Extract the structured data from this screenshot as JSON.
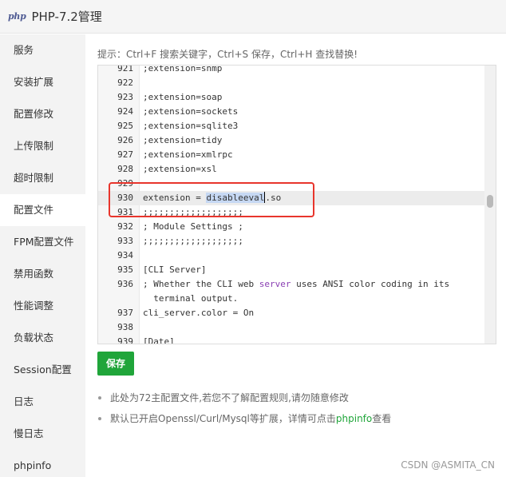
{
  "window": {
    "logo_text": "php",
    "title": "PHP-7.2管理"
  },
  "sidebar": {
    "items": [
      {
        "label": "服务"
      },
      {
        "label": "安装扩展"
      },
      {
        "label": "配置修改"
      },
      {
        "label": "上传限制"
      },
      {
        "label": "超时限制"
      },
      {
        "label": "配置文件",
        "active": true
      },
      {
        "label": "FPM配置文件"
      },
      {
        "label": "禁用函数"
      },
      {
        "label": "性能调整"
      },
      {
        "label": "负载状态"
      },
      {
        "label": "Session配置"
      },
      {
        "label": "日志"
      },
      {
        "label": "慢日志"
      },
      {
        "label": "phpinfo"
      }
    ]
  },
  "main": {
    "hint": "提示：Ctrl+F 搜索关键字，Ctrl+S 保存，Ctrl+H 查找替换!",
    "save_label": "保存",
    "notes": [
      {
        "text": "此处为72主配置文件,若您不了解配置规则,请勿随意修改"
      },
      {
        "text_before": "默认已开启Openssl/Curl/Mysql等扩展，详情可点击",
        "link": "phpinfo",
        "text_after": "查看"
      }
    ]
  },
  "editor": {
    "lines": [
      {
        "num": "921",
        "text": ";extension=snmp"
      },
      {
        "num": "922",
        "text": ""
      },
      {
        "num": "923",
        "text": ";extension=soap"
      },
      {
        "num": "924",
        "text": ";extension=sockets"
      },
      {
        "num": "925",
        "text": ";extension=sqlite3"
      },
      {
        "num": "926",
        "text": ";extension=tidy"
      },
      {
        "num": "927",
        "text": ";extension=xmlrpc"
      },
      {
        "num": "928",
        "text": ";extension=xsl"
      },
      {
        "num": "929",
        "text": ""
      },
      {
        "num": "930",
        "text_before": "extension = ",
        "selected": "disableeval",
        "text_after": ".so",
        "current": true
      },
      {
        "num": "931",
        "text": ";;;;;;;;;;;;;;;;;;;"
      },
      {
        "num": "932",
        "text": "; Module Settings ;"
      },
      {
        "num": "933",
        "text": ";;;;;;;;;;;;;;;;;;;"
      },
      {
        "num": "934",
        "text": ""
      },
      {
        "num": "935",
        "text": "[CLI Server]"
      },
      {
        "num": "936",
        "text_before": "; Whether the CLI web ",
        "keyword": "server",
        "text_after": " uses ANSI color coding in its"
      },
      {
        "num": "",
        "text": "  terminal output."
      },
      {
        "num": "937",
        "text": "cli_server.color = On"
      },
      {
        "num": "938",
        "text": ""
      },
      {
        "num": "939",
        "text": "[Date]"
      }
    ]
  },
  "watermark": "CSDN @ASMITA_CN",
  "colors": {
    "accent_green": "#20a53a",
    "highlight_red": "#e8352c",
    "selection": "#c6d8f3",
    "keyword_purple": "#8a3fb3"
  }
}
